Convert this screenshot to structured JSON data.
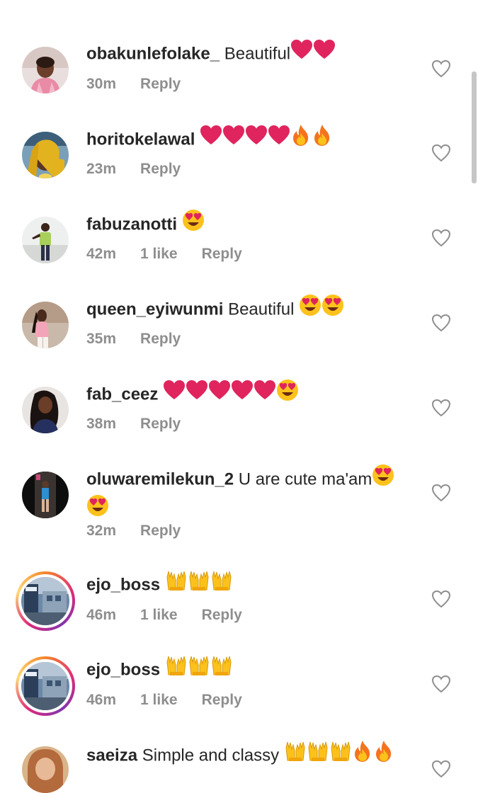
{
  "comments": [
    {
      "username": "obakunlefolake_",
      "text": "Beautiful",
      "emojis": [
        "heart",
        "heart"
      ],
      "time": "30m",
      "likes": "",
      "reply": "Reply",
      "avatar": "avatar-woman-pink"
    },
    {
      "username": "horitokelawal",
      "text": "",
      "emojis": [
        "heart",
        "heart",
        "heart",
        "heart",
        "fire",
        "fire"
      ],
      "time": "23m",
      "likes": "",
      "reply": "Reply",
      "avatar": "avatar-woman-yellow"
    },
    {
      "username": "fabuzanotti",
      "text": "",
      "emojis": [
        "heart-eyes"
      ],
      "time": "42m",
      "likes": "1 like",
      "reply": "Reply",
      "avatar": "avatar-man-standing"
    },
    {
      "username": "queen_eyiwunmi",
      "text": "Beautiful",
      "emojis": [
        "heart-eyes",
        "heart-eyes"
      ],
      "time": "35m",
      "likes": "",
      "reply": "Reply",
      "avatar": "avatar-woman-pink-top"
    },
    {
      "username": "fab_ceez",
      "text": "",
      "emojis": [
        "heart",
        "heart",
        "heart",
        "heart",
        "heart",
        "heart-eyes"
      ],
      "time": "38m",
      "likes": "",
      "reply": "Reply",
      "avatar": "avatar-woman-blue"
    },
    {
      "username": "oluwaremilekun_2",
      "text": "U are cute ma'am",
      "emojis": [
        "heart-eyes"
      ],
      "emojis_line2": [
        "heart-eyes"
      ],
      "time": "32m",
      "likes": "",
      "reply": "Reply",
      "avatar": "avatar-dark-figure"
    },
    {
      "username": "ejo_boss",
      "text": "",
      "emojis": [
        "raised-hands",
        "raised-hands",
        "raised-hands"
      ],
      "time": "46m",
      "likes": "1 like",
      "reply": "Reply",
      "avatar": "avatar-story-ring-shop"
    },
    {
      "username": "ejo_boss",
      "text": "",
      "emojis": [
        "raised-hands",
        "raised-hands",
        "raised-hands"
      ],
      "time": "46m",
      "likes": "1 like",
      "reply": "Reply",
      "avatar": "avatar-story-ring-shop"
    },
    {
      "username": "saeiza",
      "text": "Simple and classy",
      "emojis": [
        "raised-hands",
        "raised-hands",
        "raised-hands",
        "fire",
        "fire"
      ],
      "time": "",
      "likes": "",
      "reply": "",
      "avatar": "avatar-woman-partial"
    }
  ],
  "colors": {
    "text": "#262626",
    "meta": "#8e8e8e",
    "heart_emoji": "#e0245e",
    "like_icon": "#8e8e8e"
  },
  "icons": {
    "like_button": "heart-outline-icon"
  }
}
